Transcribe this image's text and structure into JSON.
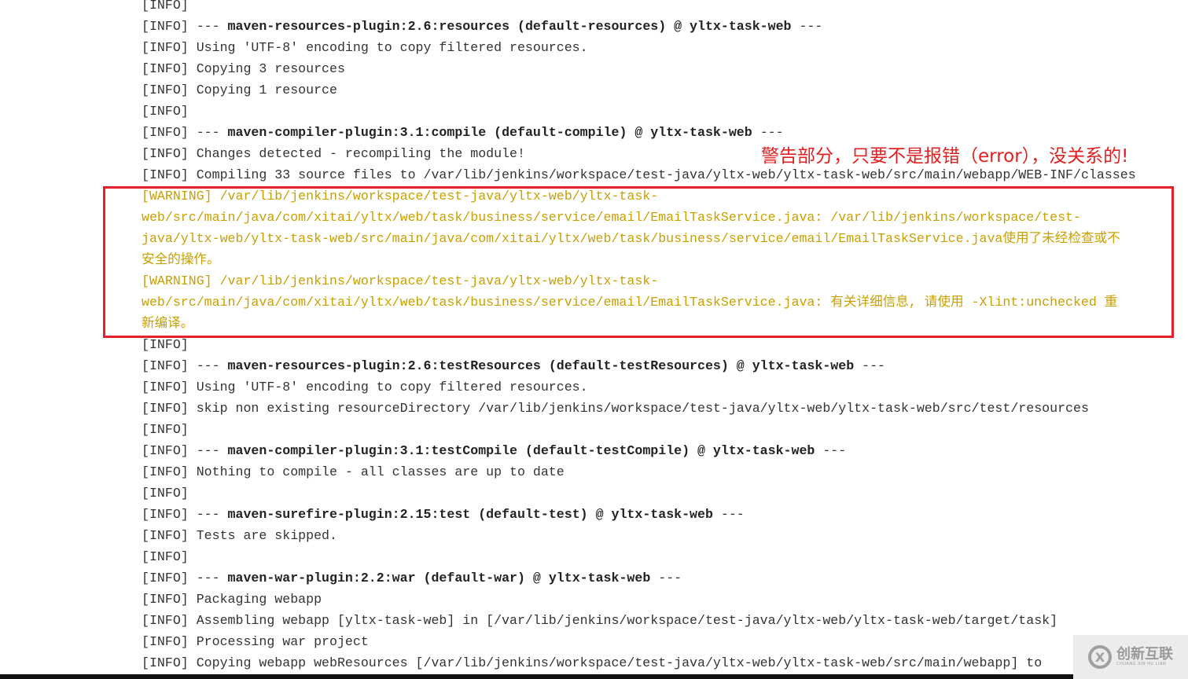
{
  "log_lines": [
    {
      "prefix": "[INFO]",
      "bold": "",
      "suffix": "",
      "type": "info"
    },
    {
      "prefix": "[INFO] --- ",
      "bold": "maven-resources-plugin:2.6:resources (default-resources) @ yltx-task-web",
      "suffix": " ---",
      "type": "info"
    },
    {
      "prefix": "[INFO] Using 'UTF-8' encoding to copy filtered resources.",
      "bold": "",
      "suffix": "",
      "type": "info"
    },
    {
      "prefix": "[INFO] Copying 3 resources",
      "bold": "",
      "suffix": "",
      "type": "info"
    },
    {
      "prefix": "[INFO] Copying 1 resource",
      "bold": "",
      "suffix": "",
      "type": "info"
    },
    {
      "prefix": "[INFO]",
      "bold": "",
      "suffix": "",
      "type": "info"
    },
    {
      "prefix": "[INFO] --- ",
      "bold": "maven-compiler-plugin:3.1:compile (default-compile) @ yltx-task-web",
      "suffix": " ---",
      "type": "info"
    },
    {
      "prefix": "[INFO] Changes detected - recompiling the module!",
      "bold": "",
      "suffix": "",
      "type": "info"
    },
    {
      "prefix": "[INFO] Compiling 33 source files to /var/lib/jenkins/workspace/test-java/yltx-web/yltx-task-web/src/main/webapp/WEB-INF/classes",
      "bold": "",
      "suffix": "",
      "type": "info"
    },
    {
      "prefix": "[WARNING] /var/lib/jenkins/workspace/test-java/yltx-web/yltx-task-",
      "bold": "",
      "suffix": "",
      "type": "warn"
    },
    {
      "prefix": "web/src/main/java/com/xitai/yltx/web/task/business/service/email/EmailTaskService.java: /var/lib/jenkins/workspace/test-",
      "bold": "",
      "suffix": "",
      "type": "warn"
    },
    {
      "prefix": "java/yltx-web/yltx-task-web/src/main/java/com/xitai/yltx/web/task/business/service/email/EmailTaskService.java使用了未经检查或不",
      "bold": "",
      "suffix": "",
      "type": "warn"
    },
    {
      "prefix": "安全的操作。",
      "bold": "",
      "suffix": "",
      "type": "warn"
    },
    {
      "prefix": "[WARNING] /var/lib/jenkins/workspace/test-java/yltx-web/yltx-task-",
      "bold": "",
      "suffix": "",
      "type": "warn"
    },
    {
      "prefix": "web/src/main/java/com/xitai/yltx/web/task/business/service/email/EmailTaskService.java: 有关详细信息, 请使用 -Xlint:unchecked 重",
      "bold": "",
      "suffix": "",
      "type": "warn"
    },
    {
      "prefix": "新编译。",
      "bold": "",
      "suffix": "",
      "type": "warn"
    },
    {
      "prefix": "[INFO]",
      "bold": "",
      "suffix": "",
      "type": "info"
    },
    {
      "prefix": "[INFO] --- ",
      "bold": "maven-resources-plugin:2.6:testResources (default-testResources) @ yltx-task-web",
      "suffix": " ---",
      "type": "info"
    },
    {
      "prefix": "[INFO] Using 'UTF-8' encoding to copy filtered resources.",
      "bold": "",
      "suffix": "",
      "type": "info"
    },
    {
      "prefix": "[INFO] skip non existing resourceDirectory /var/lib/jenkins/workspace/test-java/yltx-web/yltx-task-web/src/test/resources",
      "bold": "",
      "suffix": "",
      "type": "info"
    },
    {
      "prefix": "[INFO]",
      "bold": "",
      "suffix": "",
      "type": "info"
    },
    {
      "prefix": "[INFO] --- ",
      "bold": "maven-compiler-plugin:3.1:testCompile (default-testCompile) @ yltx-task-web",
      "suffix": " ---",
      "type": "info"
    },
    {
      "prefix": "[INFO] Nothing to compile - all classes are up to date",
      "bold": "",
      "suffix": "",
      "type": "info"
    },
    {
      "prefix": "[INFO]",
      "bold": "",
      "suffix": "",
      "type": "info"
    },
    {
      "prefix": "[INFO] --- ",
      "bold": "maven-surefire-plugin:2.15:test (default-test) @ yltx-task-web",
      "suffix": " ---",
      "type": "info"
    },
    {
      "prefix": "[INFO] Tests are skipped.",
      "bold": "",
      "suffix": "",
      "type": "info"
    },
    {
      "prefix": "[INFO]",
      "bold": "",
      "suffix": "",
      "type": "info"
    },
    {
      "prefix": "[INFO] --- ",
      "bold": "maven-war-plugin:2.2:war (default-war) @ yltx-task-web",
      "suffix": " ---",
      "type": "info"
    },
    {
      "prefix": "[INFO] Packaging webapp",
      "bold": "",
      "suffix": "",
      "type": "info"
    },
    {
      "prefix": "[INFO] Assembling webapp [yltx-task-web] in [/var/lib/jenkins/workspace/test-java/yltx-web/yltx-task-web/target/task]",
      "bold": "",
      "suffix": "",
      "type": "info"
    },
    {
      "prefix": "[INFO] Processing war project",
      "bold": "",
      "suffix": "",
      "type": "info"
    },
    {
      "prefix": "[INFO] Copying webapp webResources [/var/lib/jenkins/workspace/test-java/yltx-web/yltx-task-web/src/main/webapp] to",
      "bold": "",
      "suffix": "",
      "type": "info"
    }
  ],
  "annotation": "警告部分，只要不是报错（error），没关系的!",
  "colors": {
    "warning": "#c9a000",
    "annotation": "#e02020",
    "highlight_box": "#e3202b"
  },
  "watermark": {
    "name": "创新互联",
    "pinyin": "CHUANG XIN HU LIAN",
    "icon": "cx-logo-icon"
  }
}
